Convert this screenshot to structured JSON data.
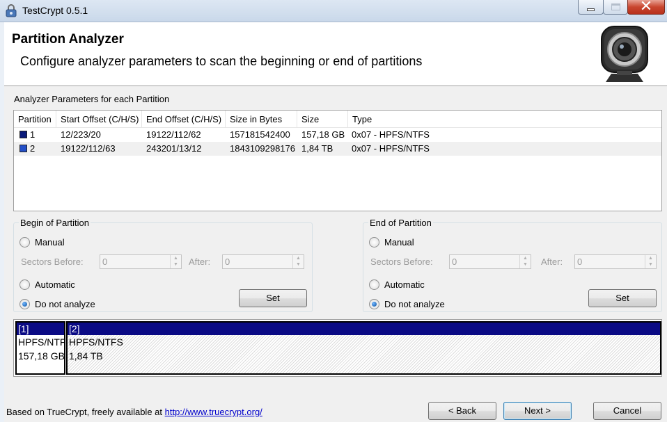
{
  "window": {
    "title": "TestCrypt 0.5.1",
    "controls": {
      "minimize": "minimize-icon",
      "maximize": "maximize-icon",
      "close": "close-icon"
    }
  },
  "header": {
    "title": "Partition Analyzer",
    "subtitle": "Configure analyzer parameters to scan the beginning or end of partitions",
    "logo": "webcam-icon"
  },
  "params_label": "Analyzer Parameters for each Partition",
  "table": {
    "columns": [
      "Partition",
      "Start Offset (C/H/S)",
      "End Offset (C/H/S)",
      "Size in Bytes",
      "Size",
      "Type"
    ],
    "rows": [
      {
        "partition": "1",
        "start": "12/223/20",
        "end": "19122/112/62",
        "bytes": "157181542400",
        "size": "157,18 GB",
        "type": "0x07 - HPFS/NTFS",
        "color": "#0a1a7a"
      },
      {
        "partition": "2",
        "start": "19122/112/63",
        "end": "243201/13/12",
        "bytes": "1843109298176",
        "size": "1,84 TB",
        "type": "0x07 - HPFS/NTFS",
        "color": "#2450c8"
      }
    ]
  },
  "begin": {
    "label": "Begin of Partition",
    "manual": "Manual",
    "sectors_before_label": "Sectors Before:",
    "sectors_before_value": "0",
    "after_label": "After:",
    "after_value": "0",
    "automatic": "Automatic",
    "do_not_analyze": "Do not analyze",
    "selected": "do_not_analyze",
    "set_label": "Set"
  },
  "end": {
    "label": "End of Partition",
    "manual": "Manual",
    "sectors_before_label": "Sectors Before:",
    "sectors_before_value": "0",
    "after_label": "After:",
    "after_value": "0",
    "automatic": "Automatic",
    "do_not_analyze": "Do not analyze",
    "selected": "do_not_analyze",
    "set_label": "Set"
  },
  "map": {
    "segments": [
      {
        "header": "[1]",
        "type": "HPFS/NTFS",
        "size": "157,18 GB"
      },
      {
        "header": "[2]",
        "type": "HPFS/NTFS",
        "size": "1,84 TB"
      }
    ]
  },
  "footer": {
    "text": "Based on TrueCrypt, freely available at ",
    "link": "http://www.truecrypt.org/",
    "back": "< Back",
    "next": "Next >",
    "cancel": "Cancel"
  },
  "colors": {
    "map_header": "#0a0a84",
    "link": "#0000cc"
  }
}
